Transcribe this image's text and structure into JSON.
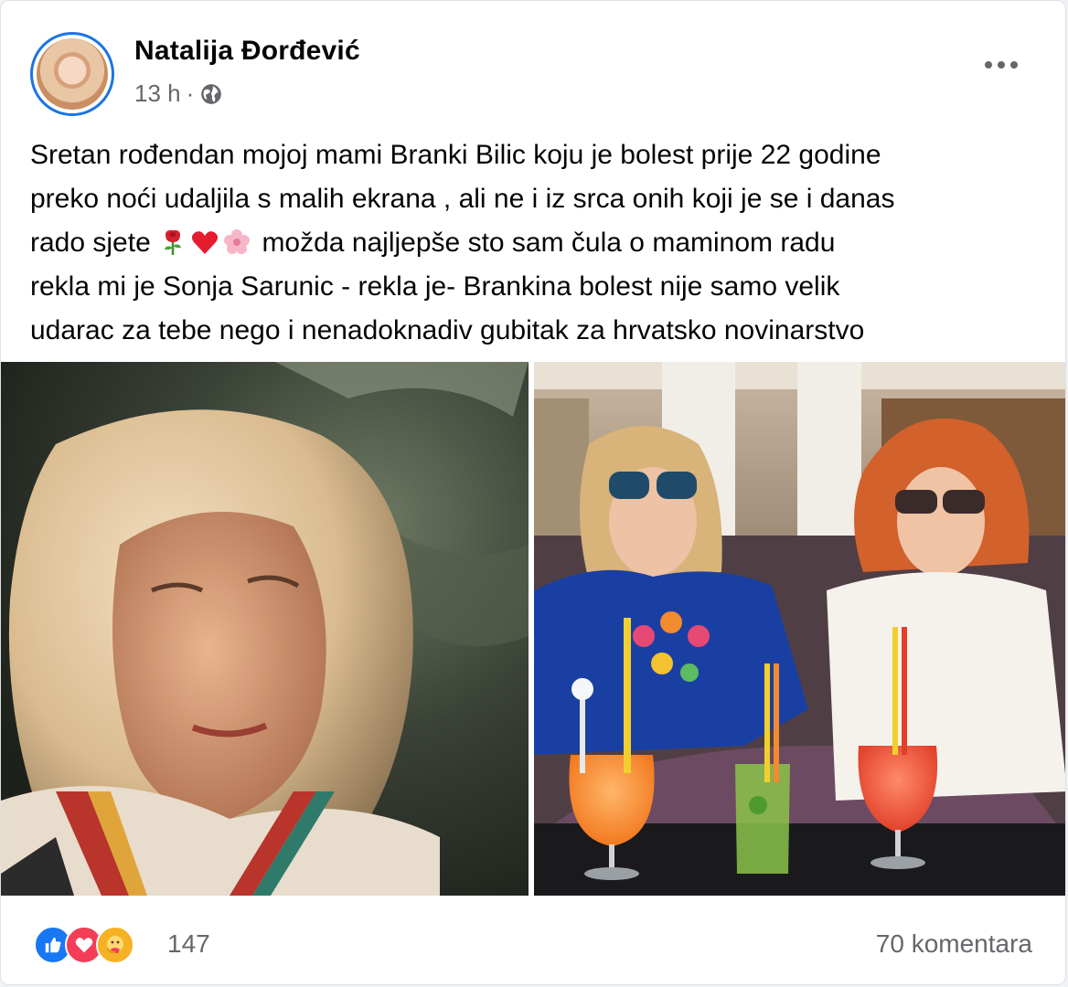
{
  "post": {
    "author": "Natalija Đorđević",
    "time": "13 h",
    "separator": "·",
    "privacy_icon": "globe-icon",
    "more_icon": "more-horizontal-icon",
    "text_lines": [
      "Sretan rođendan mojoj mami Branki Bilic koju je bolest prije 22 godine",
      "preko noći udaljila s malih ekrana , ali ne i iz srca onih koji je se i danas",
      "rado sjete",
      "možda najljepše sto sam čula o maminom radu",
      "rekla mi je Sonja Sarunic - rekla je- Brankina bolest nije samo velik",
      "udarac za tebe nego i nenadoknadiv gubitak za hrvatsko novinarstvo"
    ],
    "inline_emojis": [
      "rose-icon",
      "red-heart-icon",
      "cherry-blossom-icon"
    ]
  },
  "photos": [
    {
      "name": "vintage-portrait-photo"
    },
    {
      "name": "two-women-cocktails-photo"
    }
  ],
  "footer": {
    "reaction_icons": [
      "like-icon",
      "love-icon",
      "care-icon"
    ],
    "reaction_count": "147",
    "comments": "70 komentara"
  },
  "colors": {
    "like": "#1877f2",
    "love": "#f33e58",
    "care": "#f7b125",
    "secondary_text": "#65676b",
    "avatar_ring": "#1b74e4"
  }
}
